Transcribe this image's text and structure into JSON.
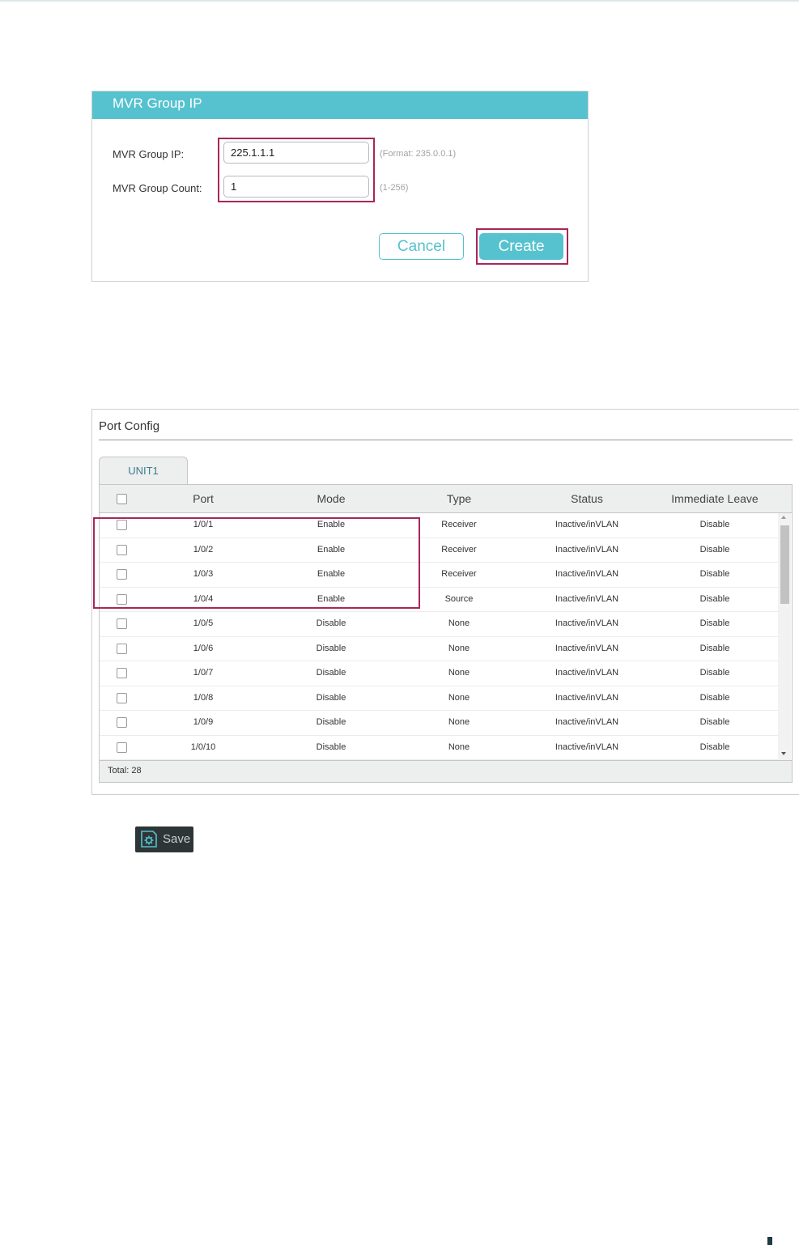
{
  "mvr_dialog": {
    "title": "MVR Group IP",
    "group_ip": {
      "label": "MVR Group IP:",
      "value": "225.1.1.1",
      "hint": "(Format: 235.0.0.1)"
    },
    "group_count": {
      "label": "MVR Group Count:",
      "value": "1",
      "hint": "(1-256)"
    },
    "cancel_label": "Cancel",
    "create_label": "Create"
  },
  "port_config": {
    "title": "Port Config",
    "tab": "UNIT1",
    "columns": [
      "Port",
      "Mode",
      "Type",
      "Status",
      "Immediate Leave"
    ],
    "rows": [
      {
        "port": "1/0/1",
        "mode": "Enable",
        "type": "Receiver",
        "status": "Inactive/inVLAN",
        "leave": "Disable"
      },
      {
        "port": "1/0/2",
        "mode": "Enable",
        "type": "Receiver",
        "status": "Inactive/inVLAN",
        "leave": "Disable"
      },
      {
        "port": "1/0/3",
        "mode": "Enable",
        "type": "Receiver",
        "status": "Inactive/inVLAN",
        "leave": "Disable"
      },
      {
        "port": "1/0/4",
        "mode": "Enable",
        "type": "Source",
        "status": "Inactive/inVLAN",
        "leave": "Disable"
      },
      {
        "port": "1/0/5",
        "mode": "Disable",
        "type": "None",
        "status": "Inactive/inVLAN",
        "leave": "Disable"
      },
      {
        "port": "1/0/6",
        "mode": "Disable",
        "type": "None",
        "status": "Inactive/inVLAN",
        "leave": "Disable"
      },
      {
        "port": "1/0/7",
        "mode": "Disable",
        "type": "None",
        "status": "Inactive/inVLAN",
        "leave": "Disable"
      },
      {
        "port": "1/0/8",
        "mode": "Disable",
        "type": "None",
        "status": "Inactive/inVLAN",
        "leave": "Disable"
      },
      {
        "port": "1/0/9",
        "mode": "Disable",
        "type": "None",
        "status": "Inactive/inVLAN",
        "leave": "Disable"
      },
      {
        "port": "1/0/10",
        "mode": "Disable",
        "type": "None",
        "status": "Inactive/inVLAN",
        "leave": "Disable"
      }
    ],
    "total": "Total: 28"
  },
  "save_button": {
    "label": "Save",
    "icon": "save-gear-icon"
  },
  "colors": {
    "accent": "#56c2cf",
    "highlight": "#a8265a",
    "save_bg": "#2e3537"
  }
}
